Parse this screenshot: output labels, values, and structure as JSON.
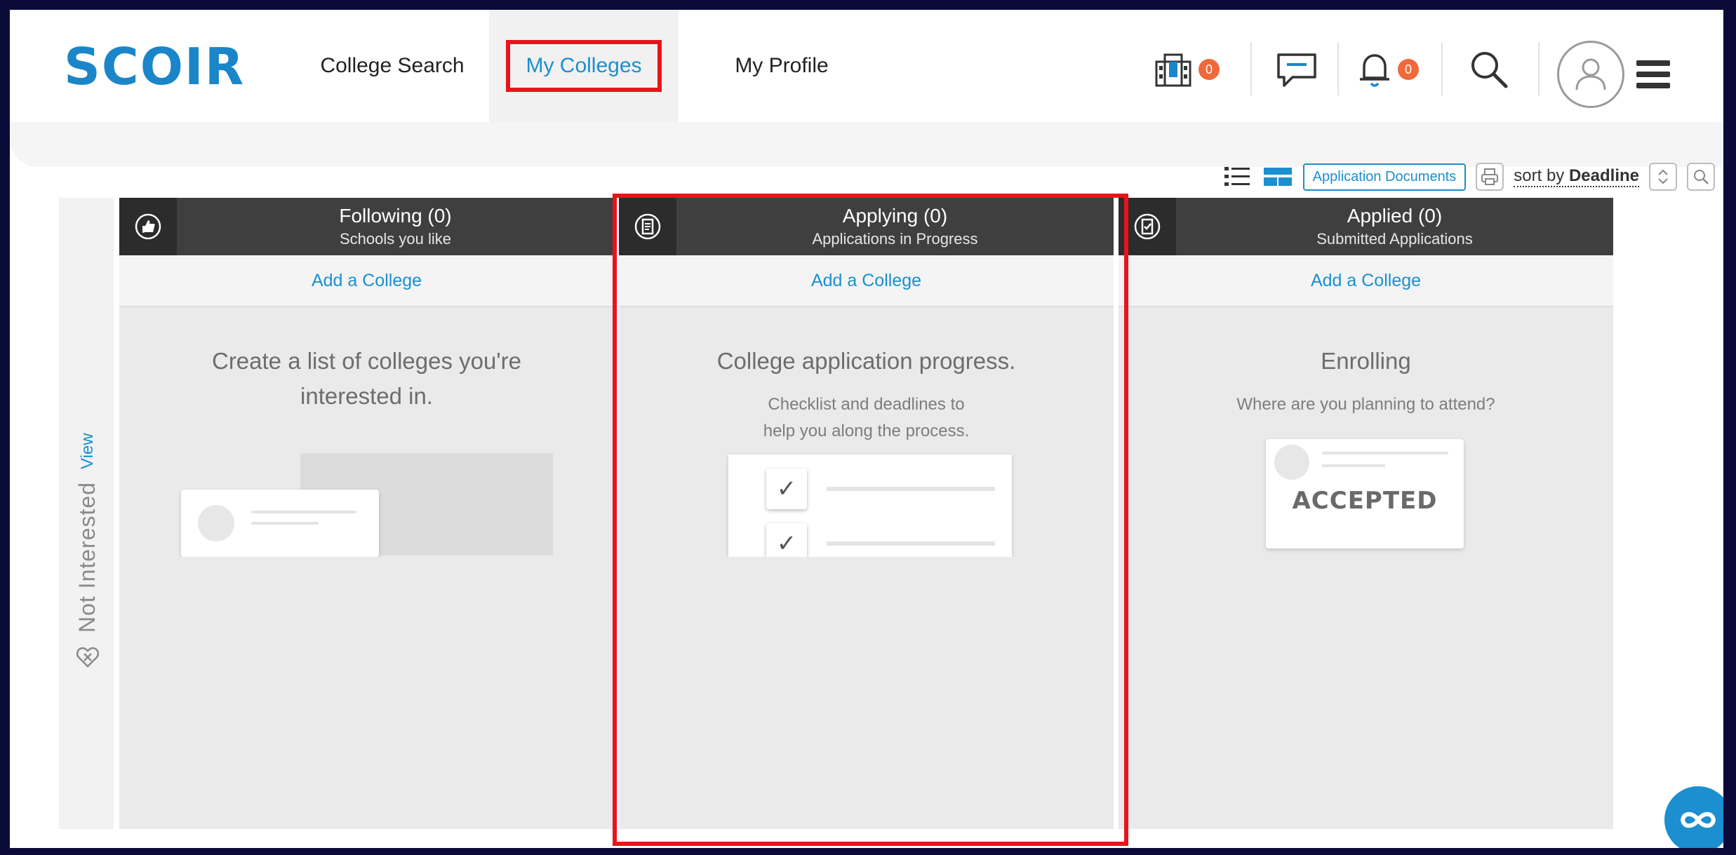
{
  "app": {
    "logo": "SCOIR"
  },
  "nav": {
    "tabs": [
      {
        "label": "College Search"
      },
      {
        "label": "My Colleges"
      },
      {
        "label": "My Profile"
      }
    ]
  },
  "header_icons": {
    "colleges_badge": "0",
    "notifications_badge": "0"
  },
  "toolbar": {
    "documents_label": "Application Documents",
    "sort_prefix": "sort by",
    "sort_value": "Deadline"
  },
  "sidebar": {
    "not_interested": "Not Interested",
    "view": "View"
  },
  "columns": [
    {
      "title": "Following (0)",
      "subtitle": "Schools you like",
      "add": "Add a College",
      "heading": "Create a list of colleges you're interested in.",
      "desc": ""
    },
    {
      "title": "Applying (0)",
      "subtitle": "Applications in Progress",
      "add": "Add a College",
      "heading": "College application progress.",
      "desc": "Checklist and deadlines to help you along the process."
    },
    {
      "title": "Applied (0)",
      "subtitle": "Submitted Applications",
      "add": "Add a College",
      "heading": "Enrolling",
      "desc": "Where are you planning to attend?",
      "card_label": "ACCEPTED"
    }
  ],
  "colors": {
    "brand": "#1a86c9",
    "link": "#1b8fcf",
    "badge": "#f0693a",
    "highlight": "#e8141b",
    "column_header": "#3f3f3f"
  }
}
